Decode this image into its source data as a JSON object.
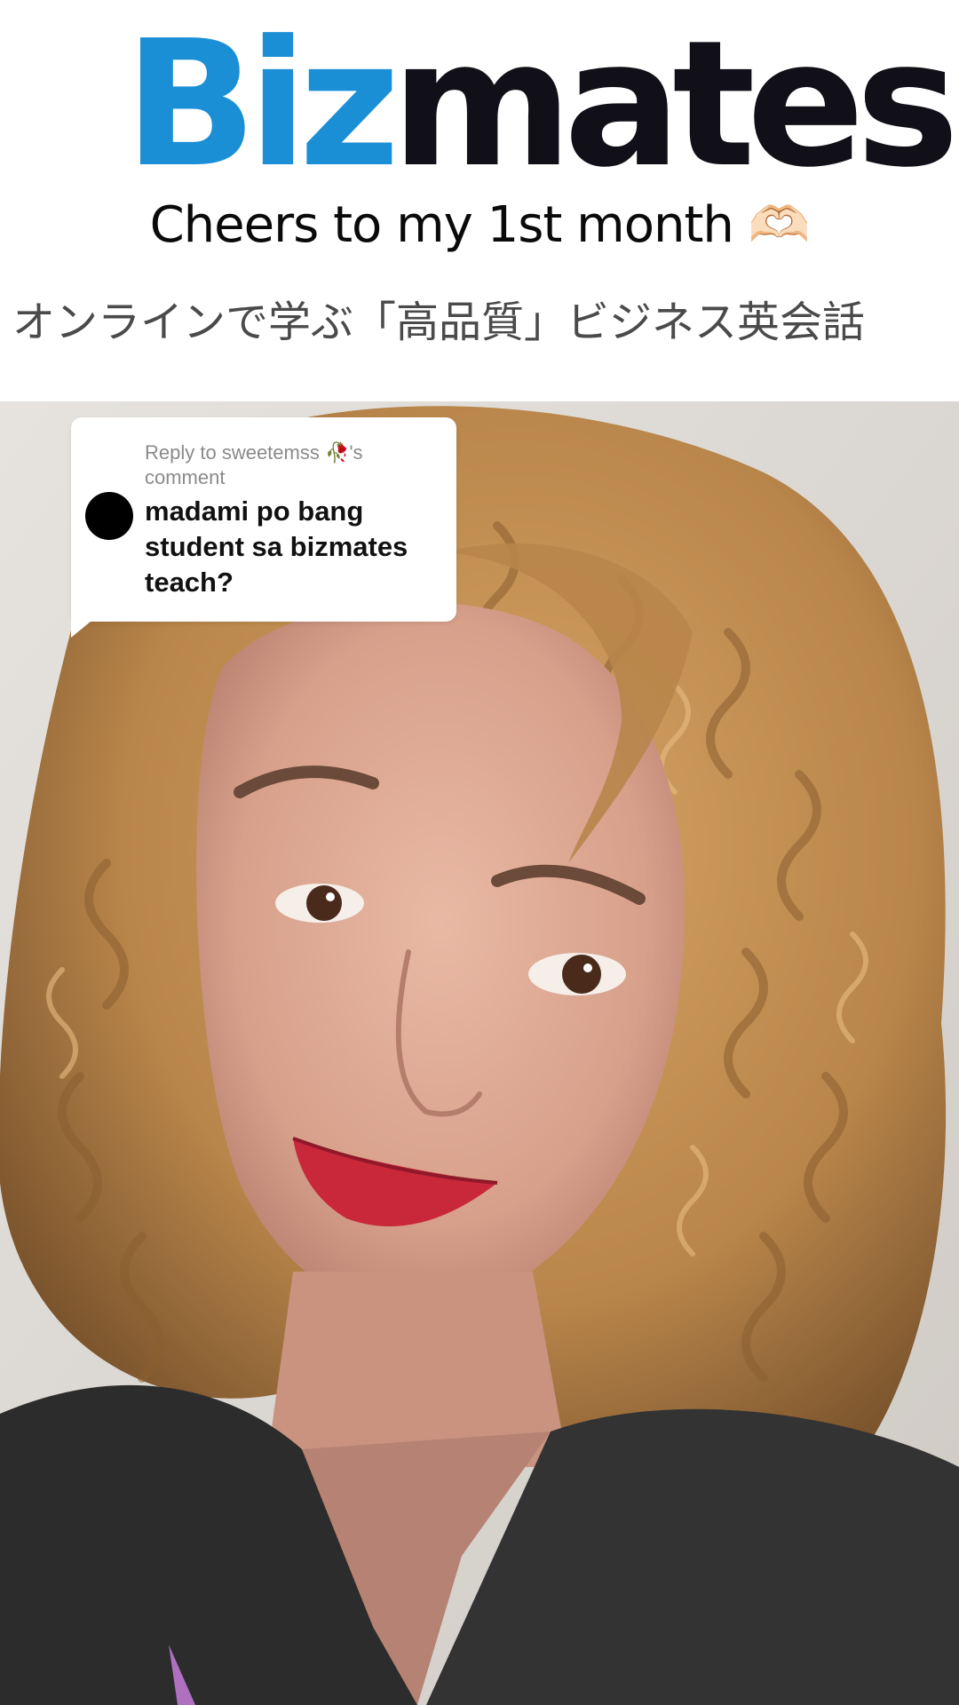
{
  "header": {
    "logo_biz": "Biz",
    "logo_mates": "mates",
    "tagline": "Cheers to my 1st month 🫶🏻",
    "subtitle": "オンラインで学ぶ「高品質」ビジネス英会話"
  },
  "reply": {
    "heading": "Reply to sweetemss 🥀's comment",
    "comment": "madami po bang student sa bizmates teach?"
  },
  "colors": {
    "brand_blue": "#1b8fd6",
    "brand_dark": "#111018",
    "lips": "#c9273a",
    "hair": "#b8854a"
  }
}
